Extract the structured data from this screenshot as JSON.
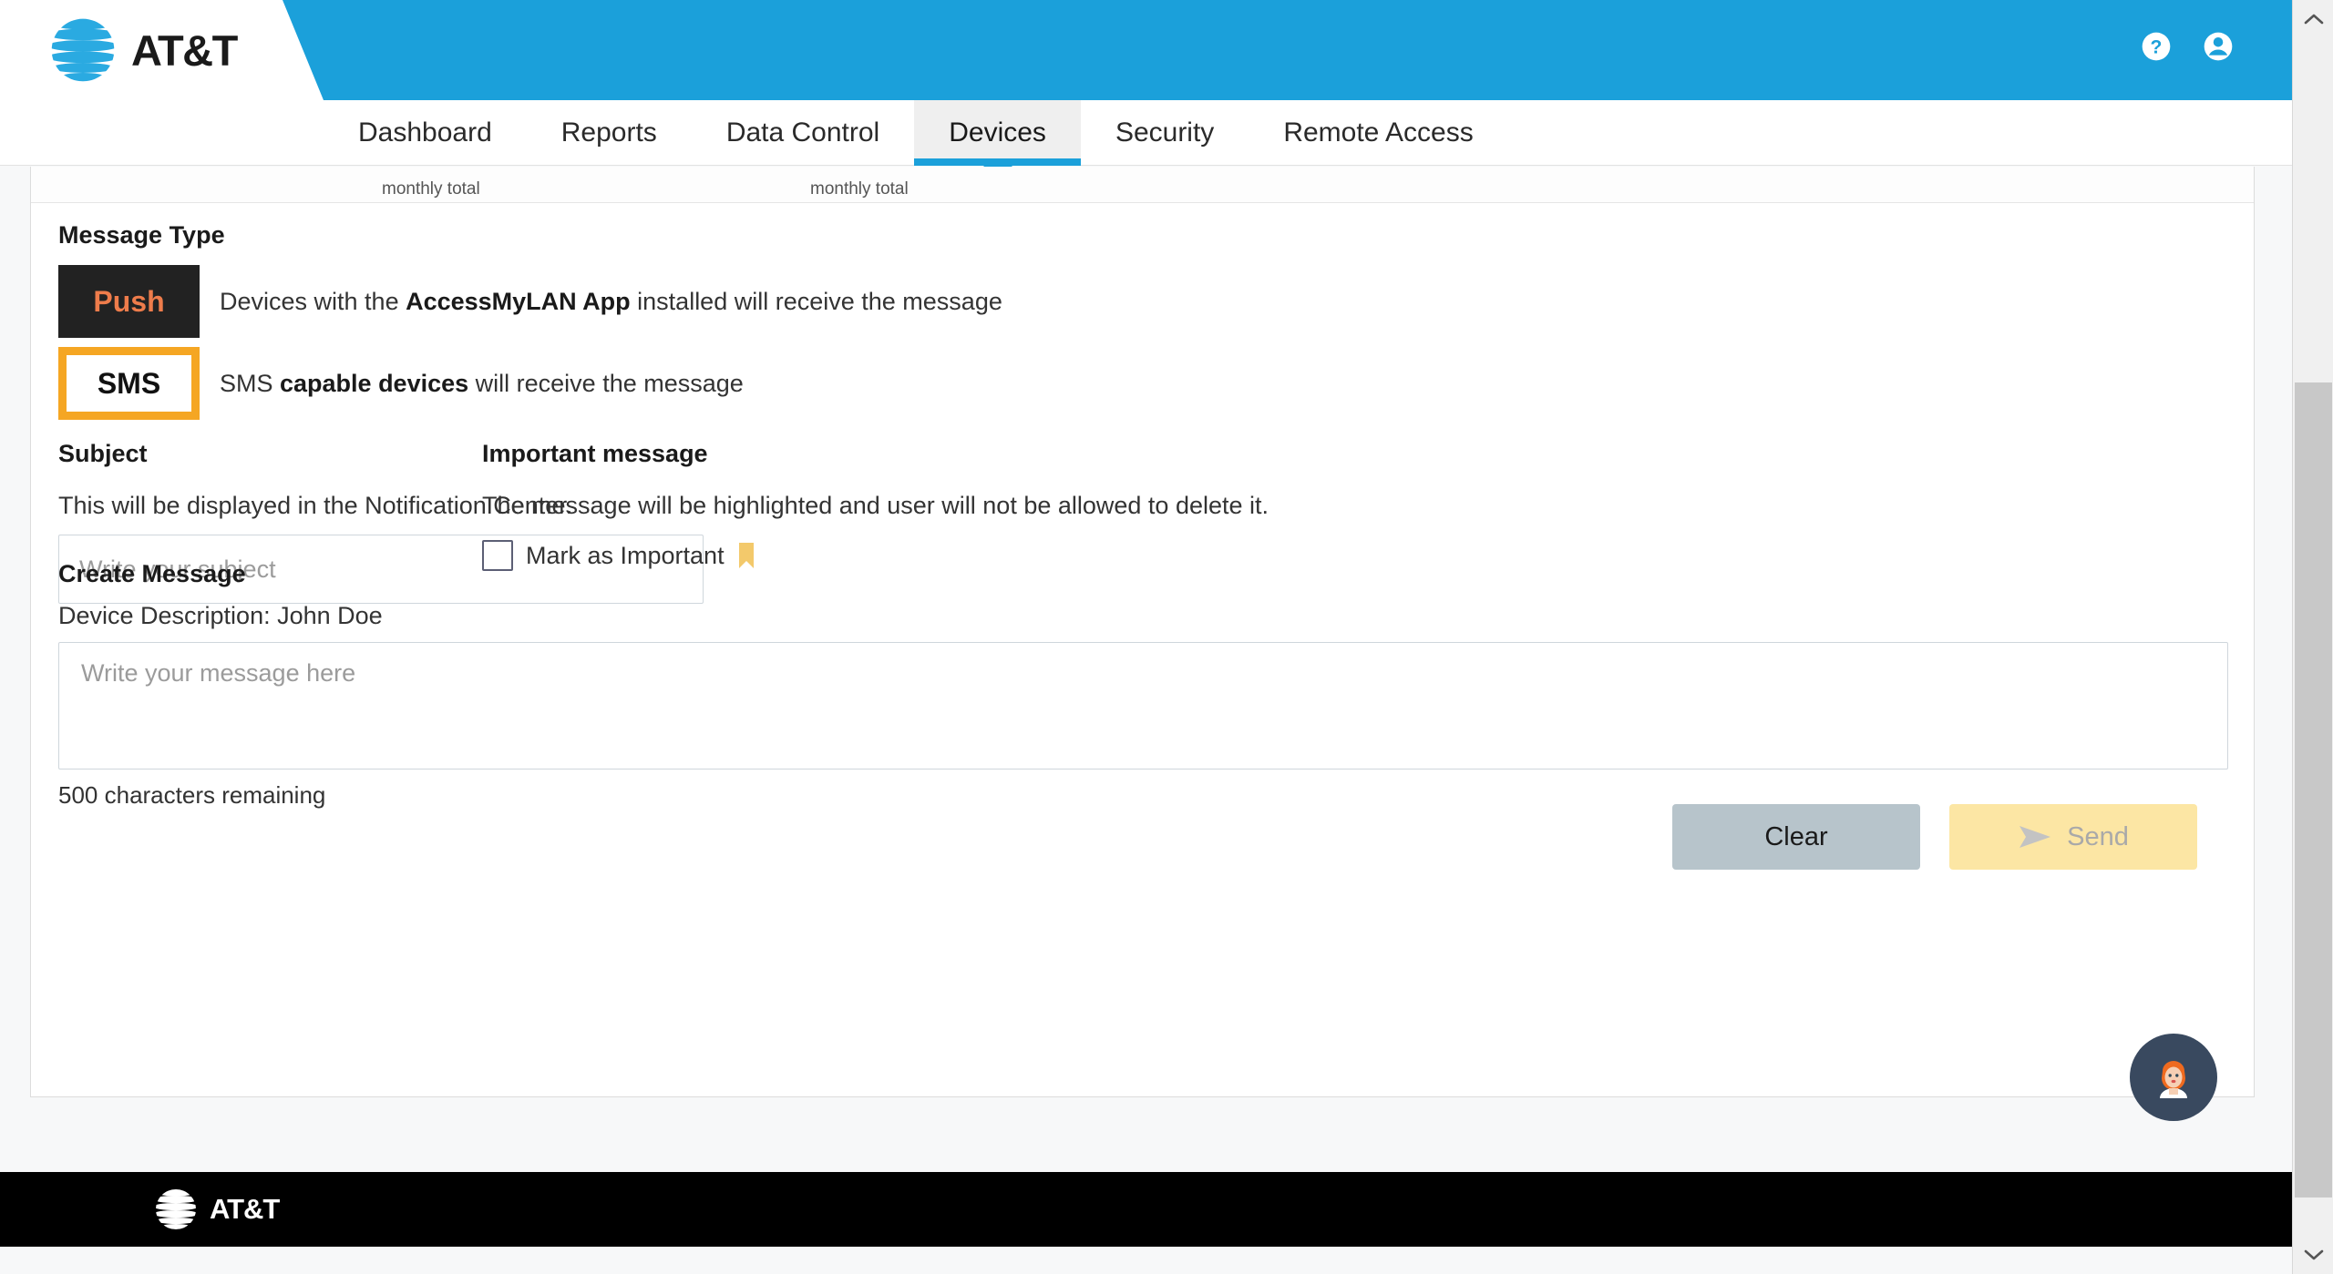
{
  "header": {
    "brand": "AT&T",
    "icons": [
      {
        "name": "help-icon",
        "label": "Help"
      },
      {
        "name": "account-icon",
        "label": "Account"
      }
    ]
  },
  "nav": {
    "items": [
      {
        "label": "Dashboard",
        "active": false
      },
      {
        "label": "Reports",
        "active": false
      },
      {
        "label": "Data Control",
        "active": false
      },
      {
        "label": "Devices",
        "active": true
      },
      {
        "label": "Security",
        "active": false
      },
      {
        "label": "Remote Access",
        "active": false
      }
    ]
  },
  "stats": {
    "left_caption": "monthly total",
    "right_caption": "monthly total"
  },
  "message_type": {
    "title": "Message Type",
    "push": {
      "chip": "Push",
      "desc_before": "Devices with the ",
      "desc_bold": "AccessMyLAN App",
      "desc_after": " installed will receive the message"
    },
    "sms": {
      "chip": "SMS",
      "desc_before": "SMS ",
      "desc_bold": "capable devices",
      "desc_after": " will receive the message",
      "selected": true
    }
  },
  "subject": {
    "title": "Subject",
    "help": "This will be displayed in the Notification Center.",
    "placeholder": "Write your subject",
    "value": ""
  },
  "important": {
    "title": "Important message",
    "help": "The message will be highlighted and user will not be allowed to delete it.",
    "checkbox_label": "Mark as Important",
    "checked": false
  },
  "create_message": {
    "title": "Create Message",
    "device_description": "Device Description: John Doe",
    "placeholder": "Write your message here",
    "value": "",
    "char_count": "500 characters remaining"
  },
  "actions": {
    "clear_label": "Clear",
    "send_label": "Send"
  },
  "chat": {
    "name": "chat-assistant-avatar"
  },
  "footer": {
    "brand": "AT&T"
  },
  "colors": {
    "header_blue": "#1ba0da",
    "accent_orange": "#f5a623",
    "push_bg": "#222222",
    "push_text": "#ee7c4b",
    "clear_btn": "#b7c4cb",
    "send_btn": "#fce6a4",
    "footer_black": "#000000"
  }
}
